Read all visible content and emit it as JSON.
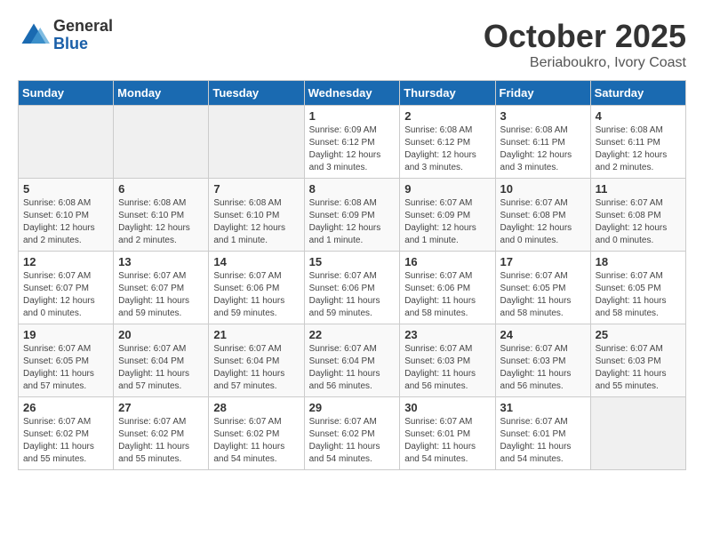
{
  "header": {
    "logo_general": "General",
    "logo_blue": "Blue",
    "month_title": "October 2025",
    "subtitle": "Beriaboukro, Ivory Coast"
  },
  "days_of_week": [
    "Sunday",
    "Monday",
    "Tuesday",
    "Wednesday",
    "Thursday",
    "Friday",
    "Saturday"
  ],
  "weeks": [
    [
      {
        "day": "",
        "info": ""
      },
      {
        "day": "",
        "info": ""
      },
      {
        "day": "",
        "info": ""
      },
      {
        "day": "1",
        "info": "Sunrise: 6:09 AM\nSunset: 6:12 PM\nDaylight: 12 hours\nand 3 minutes."
      },
      {
        "day": "2",
        "info": "Sunrise: 6:08 AM\nSunset: 6:12 PM\nDaylight: 12 hours\nand 3 minutes."
      },
      {
        "day": "3",
        "info": "Sunrise: 6:08 AM\nSunset: 6:11 PM\nDaylight: 12 hours\nand 3 minutes."
      },
      {
        "day": "4",
        "info": "Sunrise: 6:08 AM\nSunset: 6:11 PM\nDaylight: 12 hours\nand 2 minutes."
      }
    ],
    [
      {
        "day": "5",
        "info": "Sunrise: 6:08 AM\nSunset: 6:10 PM\nDaylight: 12 hours\nand 2 minutes."
      },
      {
        "day": "6",
        "info": "Sunrise: 6:08 AM\nSunset: 6:10 PM\nDaylight: 12 hours\nand 2 minutes."
      },
      {
        "day": "7",
        "info": "Sunrise: 6:08 AM\nSunset: 6:10 PM\nDaylight: 12 hours\nand 1 minute."
      },
      {
        "day": "8",
        "info": "Sunrise: 6:08 AM\nSunset: 6:09 PM\nDaylight: 12 hours\nand 1 minute."
      },
      {
        "day": "9",
        "info": "Sunrise: 6:07 AM\nSunset: 6:09 PM\nDaylight: 12 hours\nand 1 minute."
      },
      {
        "day": "10",
        "info": "Sunrise: 6:07 AM\nSunset: 6:08 PM\nDaylight: 12 hours\nand 0 minutes."
      },
      {
        "day": "11",
        "info": "Sunrise: 6:07 AM\nSunset: 6:08 PM\nDaylight: 12 hours\nand 0 minutes."
      }
    ],
    [
      {
        "day": "12",
        "info": "Sunrise: 6:07 AM\nSunset: 6:07 PM\nDaylight: 12 hours\nand 0 minutes."
      },
      {
        "day": "13",
        "info": "Sunrise: 6:07 AM\nSunset: 6:07 PM\nDaylight: 11 hours\nand 59 minutes."
      },
      {
        "day": "14",
        "info": "Sunrise: 6:07 AM\nSunset: 6:06 PM\nDaylight: 11 hours\nand 59 minutes."
      },
      {
        "day": "15",
        "info": "Sunrise: 6:07 AM\nSunset: 6:06 PM\nDaylight: 11 hours\nand 59 minutes."
      },
      {
        "day": "16",
        "info": "Sunrise: 6:07 AM\nSunset: 6:06 PM\nDaylight: 11 hours\nand 58 minutes."
      },
      {
        "day": "17",
        "info": "Sunrise: 6:07 AM\nSunset: 6:05 PM\nDaylight: 11 hours\nand 58 minutes."
      },
      {
        "day": "18",
        "info": "Sunrise: 6:07 AM\nSunset: 6:05 PM\nDaylight: 11 hours\nand 58 minutes."
      }
    ],
    [
      {
        "day": "19",
        "info": "Sunrise: 6:07 AM\nSunset: 6:05 PM\nDaylight: 11 hours\nand 57 minutes."
      },
      {
        "day": "20",
        "info": "Sunrise: 6:07 AM\nSunset: 6:04 PM\nDaylight: 11 hours\nand 57 minutes."
      },
      {
        "day": "21",
        "info": "Sunrise: 6:07 AM\nSunset: 6:04 PM\nDaylight: 11 hours\nand 57 minutes."
      },
      {
        "day": "22",
        "info": "Sunrise: 6:07 AM\nSunset: 6:04 PM\nDaylight: 11 hours\nand 56 minutes."
      },
      {
        "day": "23",
        "info": "Sunrise: 6:07 AM\nSunset: 6:03 PM\nDaylight: 11 hours\nand 56 minutes."
      },
      {
        "day": "24",
        "info": "Sunrise: 6:07 AM\nSunset: 6:03 PM\nDaylight: 11 hours\nand 56 minutes."
      },
      {
        "day": "25",
        "info": "Sunrise: 6:07 AM\nSunset: 6:03 PM\nDaylight: 11 hours\nand 55 minutes."
      }
    ],
    [
      {
        "day": "26",
        "info": "Sunrise: 6:07 AM\nSunset: 6:02 PM\nDaylight: 11 hours\nand 55 minutes."
      },
      {
        "day": "27",
        "info": "Sunrise: 6:07 AM\nSunset: 6:02 PM\nDaylight: 11 hours\nand 55 minutes."
      },
      {
        "day": "28",
        "info": "Sunrise: 6:07 AM\nSunset: 6:02 PM\nDaylight: 11 hours\nand 54 minutes."
      },
      {
        "day": "29",
        "info": "Sunrise: 6:07 AM\nSunset: 6:02 PM\nDaylight: 11 hours\nand 54 minutes."
      },
      {
        "day": "30",
        "info": "Sunrise: 6:07 AM\nSunset: 6:01 PM\nDaylight: 11 hours\nand 54 minutes."
      },
      {
        "day": "31",
        "info": "Sunrise: 6:07 AM\nSunset: 6:01 PM\nDaylight: 11 hours\nand 54 minutes."
      },
      {
        "day": "",
        "info": ""
      }
    ]
  ]
}
